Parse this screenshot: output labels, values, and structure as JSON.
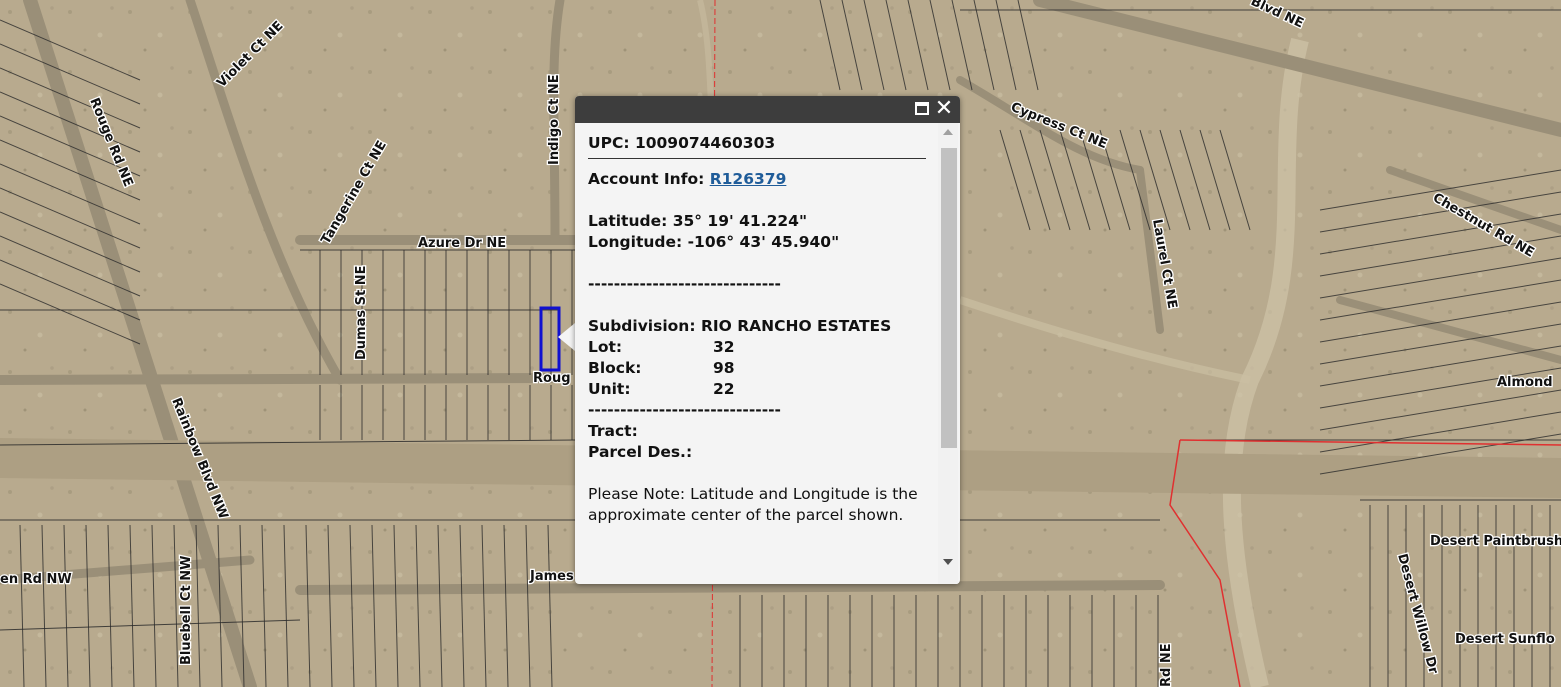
{
  "map": {
    "road_labels": [
      "Rouge Rd NE",
      "Violet Ct NE",
      "Indigo Ct NE",
      "Tangerine Ct NE",
      "Azure Dr NE",
      "Dumas St NE",
      "Roug",
      "Rainbow Blvd NW",
      "Bluebell Ct NW",
      "en Rd NW",
      "James",
      "Cypress Ct NE",
      "Laurel Ct NE",
      "Chestnut Rd NE",
      "Almond",
      "Desert Paintbrush",
      "Desert Willow Dr",
      "Desert Sunflo",
      "Blvd NE",
      "Rd NE"
    ]
  },
  "popup": {
    "upc_label": "UPC:",
    "upc_value": "1009074460303",
    "account_label": "Account Info:",
    "account_value": "R126379",
    "latitude_label": "Latitude:",
    "latitude_value": "35° 19' 41.224\"",
    "longitude_label": "Longitude:",
    "longitude_value": "-106° 43' 45.940\"",
    "divider": "------------------------------",
    "subdivision_label": "Subdivision:",
    "subdivision_value": "RIO RANCHO ESTATES",
    "lot_label": "Lot:",
    "lot_value": "32",
    "block_label": "Block:",
    "block_value": "98",
    "unit_label": "Unit:",
    "unit_value": "22",
    "tract_label": "Tract:",
    "parcel_label": "Parcel Des.:",
    "note": "Please Note: Latitude and Longitude is the approximate center of the parcel shown.",
    "icons": {
      "maximize": "maximize-icon",
      "close": "close-icon"
    }
  },
  "colors": {
    "header": "#3d3d3d",
    "link": "#1f5c99",
    "selected_parcel": "#1010d0",
    "boundary": "#e03030"
  }
}
